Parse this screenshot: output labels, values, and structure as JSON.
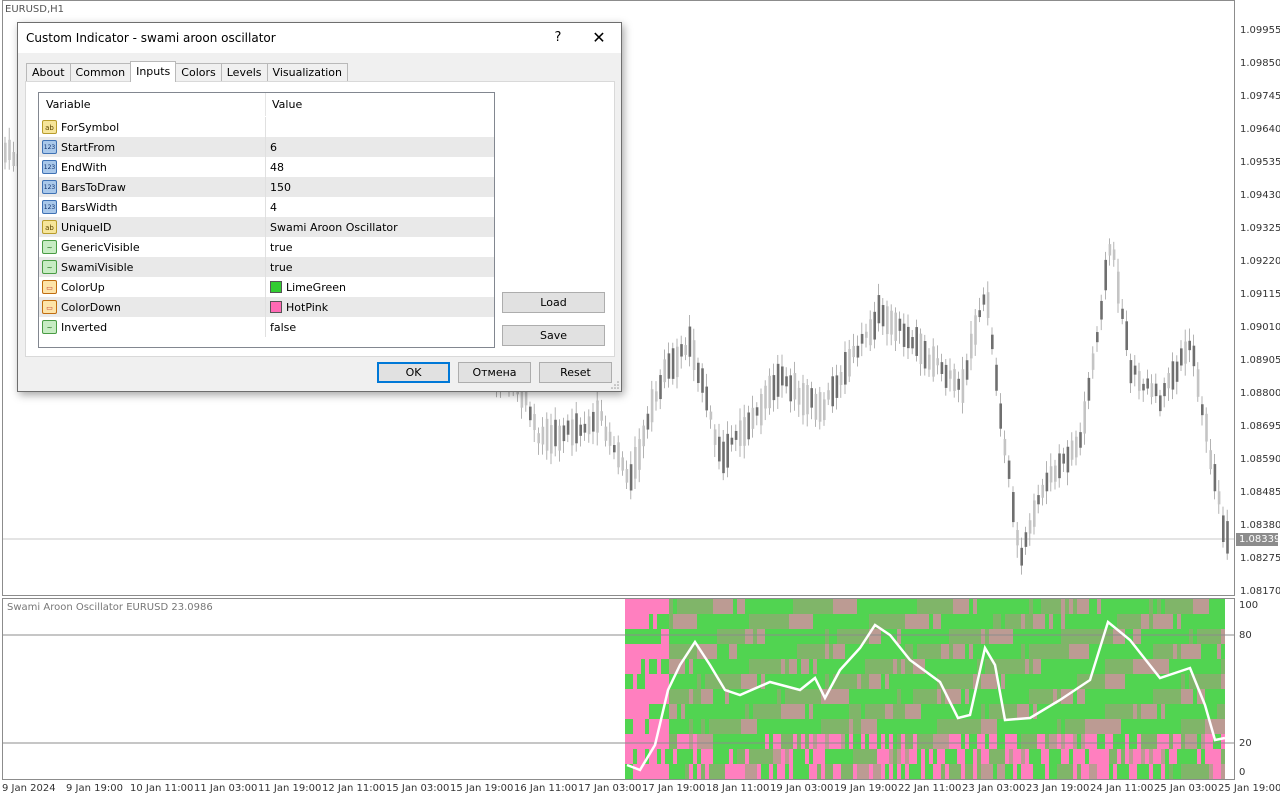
{
  "chart": {
    "symbol": "EURUSD,H1",
    "current_price": "1.08339",
    "price_axis": [
      "1.09955",
      "1.09850",
      "1.09745",
      "1.09640",
      "1.09535",
      "1.09430",
      "1.09325",
      "1.09220",
      "1.09115",
      "1.09010",
      "1.08905",
      "1.08800",
      "1.08695",
      "1.08590",
      "1.08485",
      "1.08380",
      "1.08275",
      "1.08170"
    ],
    "time_axis": [
      "9 Jan 2024",
      "9 Jan 19:00",
      "10 Jan 11:00",
      "11 Jan 03:00",
      "11 Jan 19:00",
      "12 Jan 11:00",
      "15 Jan 03:00",
      "15 Jan 19:00",
      "16 Jan 11:00",
      "17 Jan 03:00",
      "17 Jan 19:00",
      "18 Jan 11:00",
      "19 Jan 03:00",
      "19 Jan 19:00",
      "22 Jan 11:00",
      "23 Jan 03:00",
      "23 Jan 19:00",
      "24 Jan 11:00",
      "25 Jan 03:00",
      "25 Jan 19:00"
    ],
    "oscillator": {
      "title": "Swami Aroon Oscillator EURUSD 23.0986",
      "levels": [
        "100",
        "80",
        "20",
        "0"
      ]
    },
    "colors": {
      "up": "#32cd32",
      "down": "#ff69b4",
      "line": "#ffffff",
      "candle": "#808080"
    }
  },
  "dialog": {
    "title": "Custom Indicator - swami aroon oscillator",
    "help": "?",
    "close": "✕",
    "tabs": [
      {
        "label": "About"
      },
      {
        "label": "Common"
      },
      {
        "label": "Inputs"
      },
      {
        "label": "Colors"
      },
      {
        "label": "Levels"
      },
      {
        "label": "Visualization"
      }
    ],
    "table": {
      "col_variable": "Variable",
      "col_value": "Value",
      "rows": [
        {
          "icon": "ab",
          "variable": "ForSymbol",
          "value": ""
        },
        {
          "icon": "123",
          "variable": "StartFrom",
          "value": "6"
        },
        {
          "icon": "123",
          "variable": "EndWith",
          "value": "48"
        },
        {
          "icon": "123",
          "variable": "BarsToDraw",
          "value": "150"
        },
        {
          "icon": "123",
          "variable": "BarsWidth",
          "value": "4"
        },
        {
          "icon": "ab",
          "variable": "UniqueID",
          "value": "Swami Aroon Oscillator"
        },
        {
          "icon": "bool",
          "variable": "GenericVisible",
          "value": "true"
        },
        {
          "icon": "bool",
          "variable": "SwamiVisible",
          "value": "true"
        },
        {
          "icon": "color",
          "variable": "ColorUp",
          "value": "LimeGreen",
          "swatch": "#32cd32"
        },
        {
          "icon": "color",
          "variable": "ColorDown",
          "value": "HotPink",
          "swatch": "#ff69b4"
        },
        {
          "icon": "bool",
          "variable": "Inverted",
          "value": "false"
        }
      ]
    },
    "buttons": {
      "load": "Load",
      "save": "Save",
      "ok": "OK",
      "cancel": "Отмена",
      "reset": "Reset"
    }
  }
}
